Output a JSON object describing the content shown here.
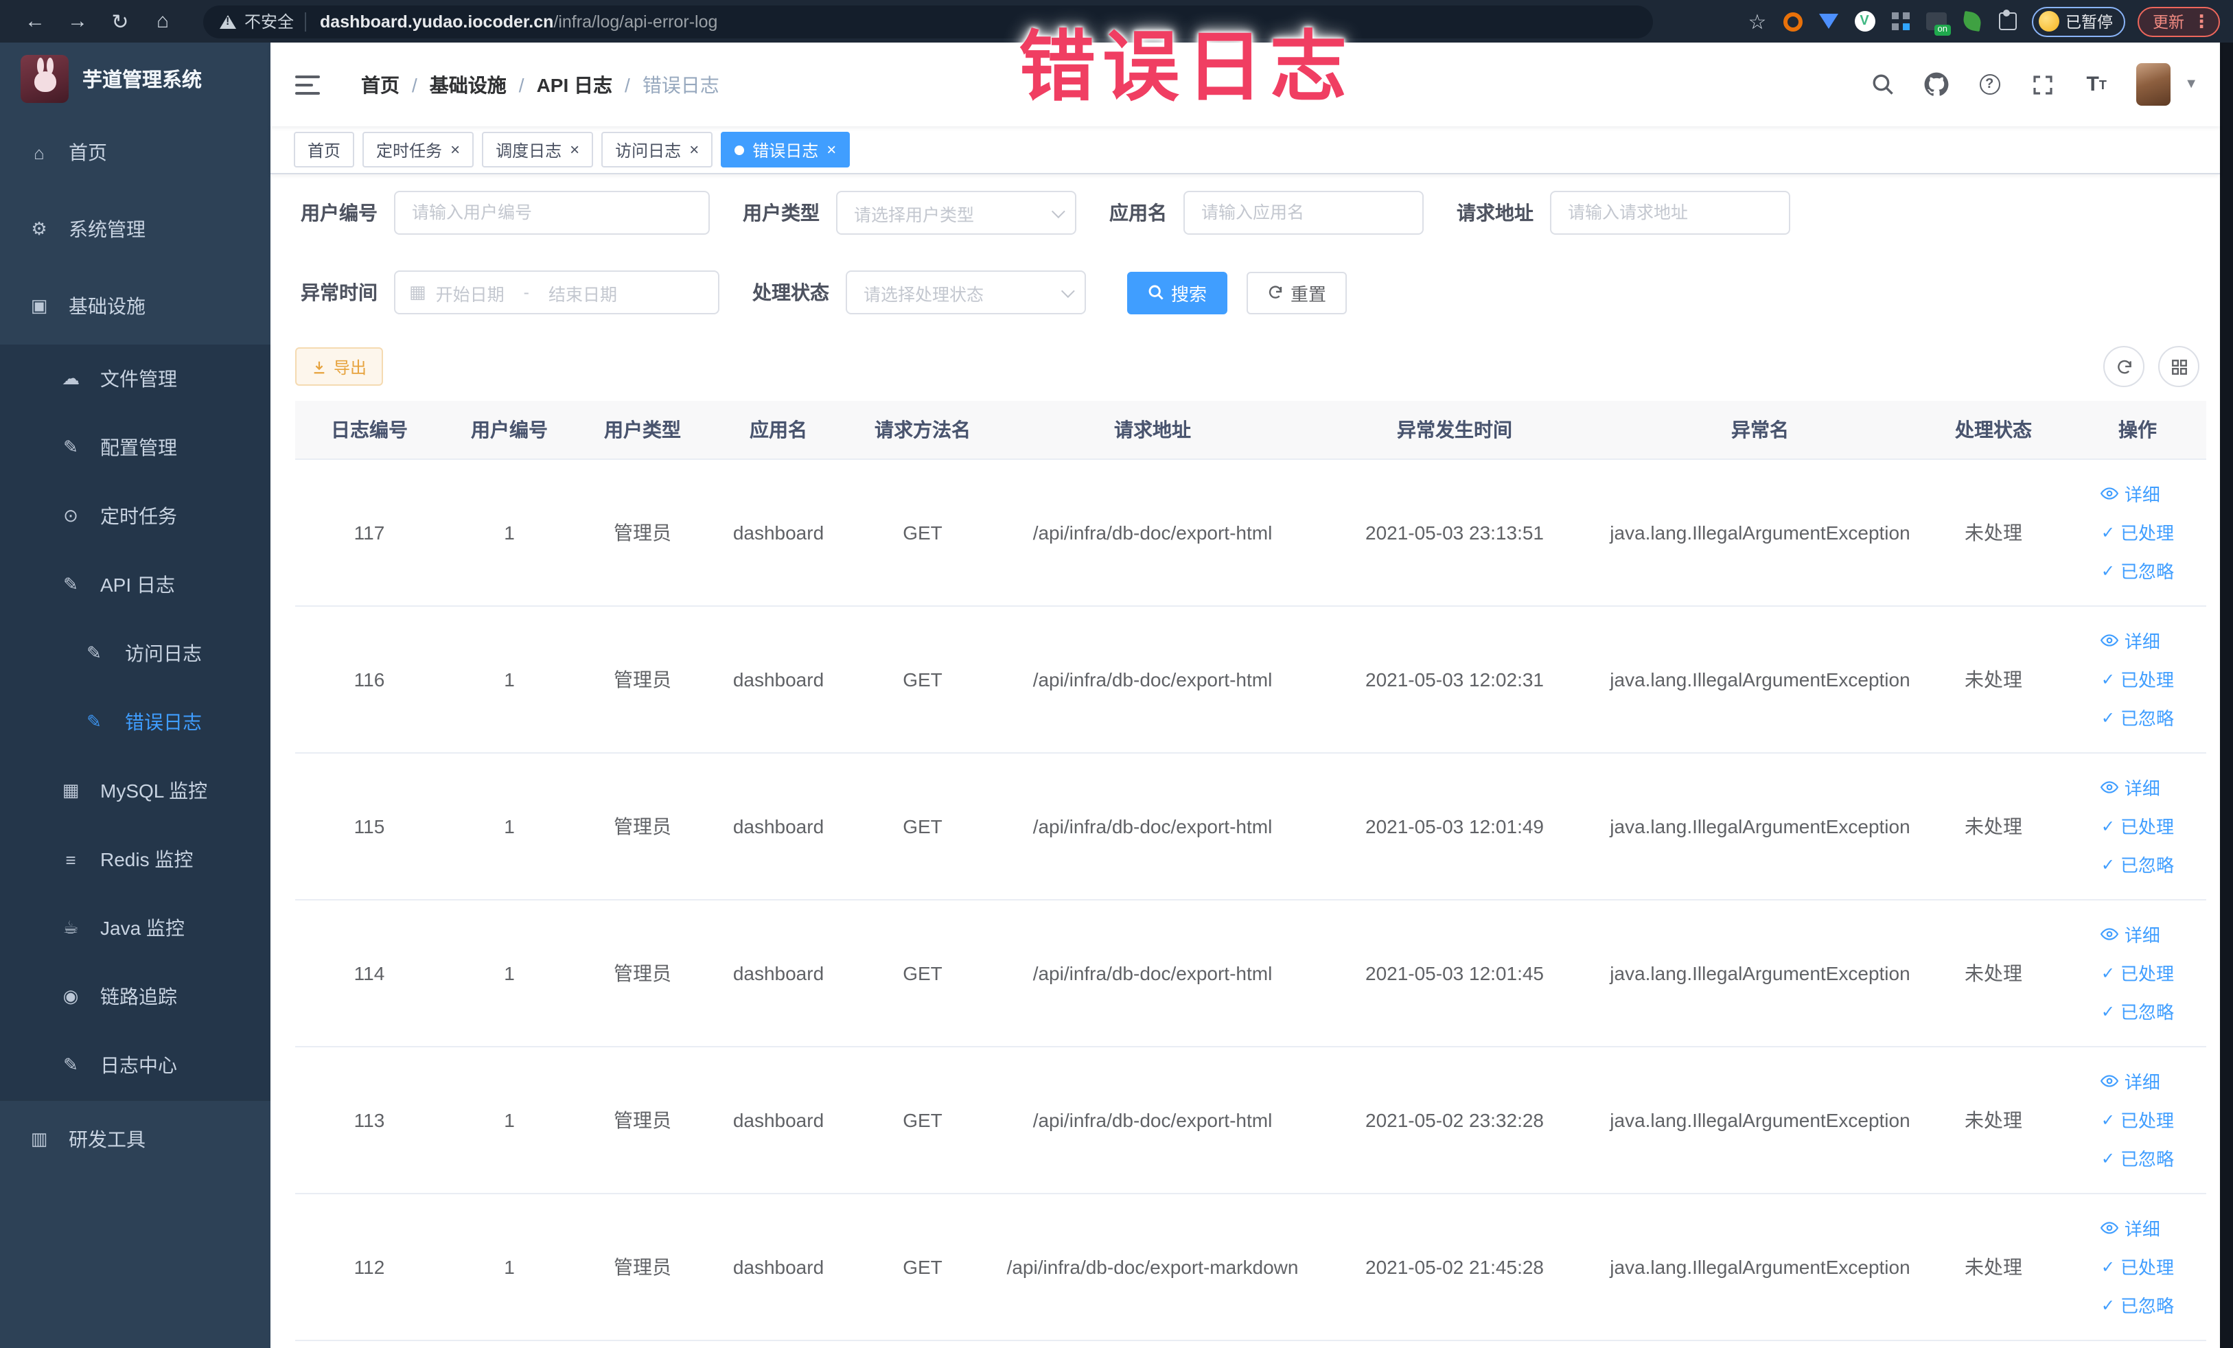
{
  "browser": {
    "security_label": "不安全",
    "url_domain": "dashboard.yudao.iocoder.cn",
    "url_path": "/infra/log/api-error-log",
    "paused_label": "已暂停",
    "update_label": "更新"
  },
  "annotation": {
    "text": "错误日志",
    "color": "#f03e62"
  },
  "sidebar": {
    "logo_title": "芋道管理系统",
    "items": [
      {
        "label": "首页",
        "icon": "home",
        "level": "0"
      },
      {
        "label": "系统管理",
        "icon": "gear",
        "level": "0",
        "chevron": "down"
      },
      {
        "label": "基础设施",
        "icon": "monitor",
        "level": "0",
        "chevron": "up"
      },
      {
        "label": "文件管理",
        "icon": "cloud-upload",
        "level": "1",
        "dark": true
      },
      {
        "label": "配置管理",
        "icon": "edit",
        "level": "1",
        "dark": true
      },
      {
        "label": "定时任务",
        "icon": "timer",
        "level": "1",
        "dark": true
      },
      {
        "label": "API 日志",
        "icon": "log",
        "level": "1",
        "dark": true,
        "chevron": "up"
      },
      {
        "label": "访问日志",
        "icon": "log",
        "level": "2",
        "dark": true
      },
      {
        "label": "错误日志",
        "icon": "log",
        "level": "2",
        "dark": true,
        "active": true
      },
      {
        "label": "MySQL 监控",
        "icon": "mysql",
        "level": "1",
        "dark": true
      },
      {
        "label": "Redis 监控",
        "icon": "redis",
        "level": "1",
        "dark": true
      },
      {
        "label": "Java 监控",
        "icon": "java",
        "level": "1",
        "dark": true
      },
      {
        "label": "链路追踪",
        "icon": "trace",
        "level": "1",
        "dark": true
      },
      {
        "label": "日志中心",
        "icon": "log",
        "level": "1",
        "dark": true
      },
      {
        "label": "研发工具",
        "icon": "tools",
        "level": "0",
        "chevron": "down",
        "divider_top": true
      }
    ]
  },
  "navbar": {
    "breadcrumb": {
      "items": [
        "首页",
        "基础设施",
        "API 日志",
        "错误日志"
      ],
      "separator": "/"
    }
  },
  "tags": [
    {
      "label": "首页"
    },
    {
      "label": "定时任务",
      "closable": true
    },
    {
      "label": "调度日志",
      "closable": true
    },
    {
      "label": "访问日志",
      "closable": true
    },
    {
      "label": "错误日志",
      "closable": true,
      "active": true
    }
  ],
  "filter": {
    "user_id_label": "用户编号",
    "user_id_placeholder": "请输入用户编号",
    "user_type_label": "用户类型",
    "user_type_placeholder": "请选择用户类型",
    "app_name_label": "应用名",
    "app_name_placeholder": "请输入应用名",
    "request_url_label": "请求地址",
    "request_url_placeholder": "请输入请求地址",
    "exception_time_label": "异常时间",
    "date_start_placeholder": "开始日期",
    "date_separator": "-",
    "date_end_placeholder": "结束日期",
    "process_status_label": "处理状态",
    "process_status_placeholder": "请选择处理状态",
    "search_label": "搜索",
    "reset_label": "重置",
    "export_label": "导出"
  },
  "table": {
    "columns": [
      "日志编号",
      "用户编号",
      "用户类型",
      "应用名",
      "请求方法名",
      "请求地址",
      "异常发生时间",
      "异常名",
      "处理状态",
      "操作"
    ],
    "actions": [
      {
        "label": "详细",
        "icon": "eye"
      },
      {
        "label": "已处理",
        "icon": "check"
      },
      {
        "label": "已忽略",
        "icon": "check"
      }
    ],
    "rows": [
      {
        "id": "117",
        "user_id": "1",
        "user_type": "管理员",
        "app": "dashboard",
        "method": "GET",
        "url": "/api/infra/db-doc/export-html",
        "time": "2021-05-03 23:13:51",
        "exception": "java.lang.IllegalArgumentException",
        "status": "未处理"
      },
      {
        "id": "116",
        "user_id": "1",
        "user_type": "管理员",
        "app": "dashboard",
        "method": "GET",
        "url": "/api/infra/db-doc/export-html",
        "time": "2021-05-03 12:02:31",
        "exception": "java.lang.IllegalArgumentException",
        "status": "未处理"
      },
      {
        "id": "115",
        "user_id": "1",
        "user_type": "管理员",
        "app": "dashboard",
        "method": "GET",
        "url": "/api/infra/db-doc/export-html",
        "time": "2021-05-03 12:01:49",
        "exception": "java.lang.IllegalArgumentException",
        "status": "未处理"
      },
      {
        "id": "114",
        "user_id": "1",
        "user_type": "管理员",
        "app": "dashboard",
        "method": "GET",
        "url": "/api/infra/db-doc/export-html",
        "time": "2021-05-03 12:01:45",
        "exception": "java.lang.IllegalArgumentException",
        "status": "未处理"
      },
      {
        "id": "113",
        "user_id": "1",
        "user_type": "管理员",
        "app": "dashboard",
        "method": "GET",
        "url": "/api/infra/db-doc/export-html",
        "time": "2021-05-02 23:32:28",
        "exception": "java.lang.IllegalArgumentException",
        "status": "未处理"
      },
      {
        "id": "112",
        "user_id": "1",
        "user_type": "管理员",
        "app": "dashboard",
        "method": "GET",
        "url": "/api/infra/db-doc/export-markdown",
        "time": "2021-05-02 21:45:28",
        "exception": "java.lang.IllegalArgumentException",
        "status": "未处理"
      }
    ]
  }
}
